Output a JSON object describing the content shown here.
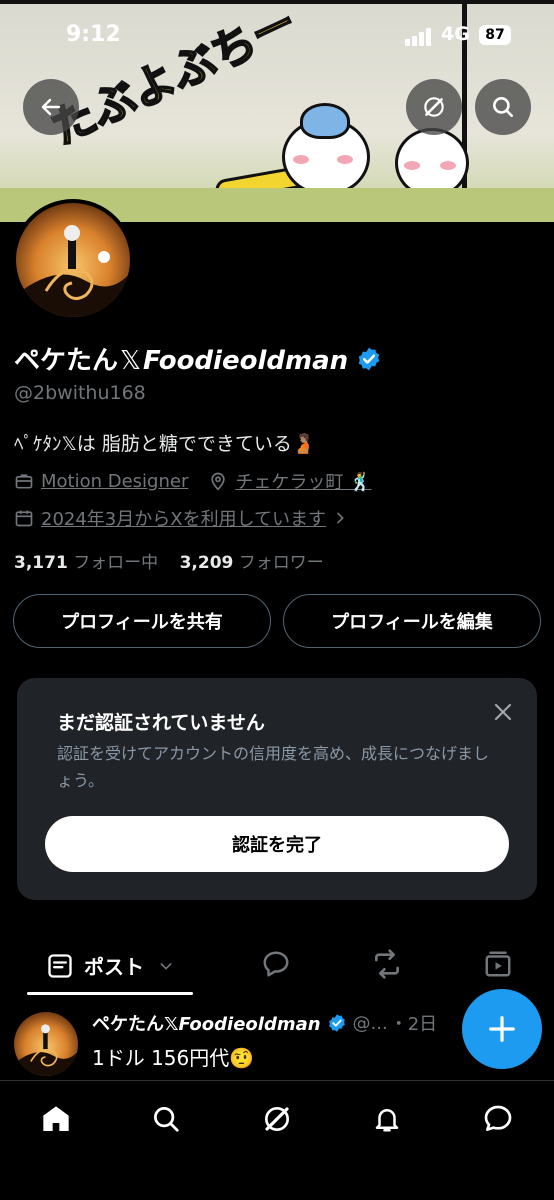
{
  "status_bar": {
    "time": "9:12",
    "network": "4G",
    "battery": "87"
  },
  "header": {
    "back_icon": "arrow-left-icon",
    "grok_icon": "grok-icon",
    "search_icon": "search-icon"
  },
  "banner": {
    "illustration_text": "たぶよぶちー"
  },
  "profile": {
    "name_jp": "ペケたん",
    "name_x": "𝕏",
    "name_en": "Foodieoldman",
    "handle": "@2bwithu168",
    "bio": "ﾍﾟｹﾀﾝ𝕏は 脂肪と糖でできている🫄🏽",
    "job": "Motion Designer",
    "location": "チェケラッ町 🕺",
    "joined": "2024年3月からXを利用しています",
    "following_count": "3,171",
    "following_label": "フォロー中",
    "followers_count": "3,209",
    "followers_label": "フォロワー"
  },
  "actions": {
    "share": "プロフィールを共有",
    "edit": "プロフィールを編集"
  },
  "verify_card": {
    "title": "まだ認証されていません",
    "description": "認証を受けてアカウントの信用度を高め、成長につなげましょう。",
    "button": "認証を完了"
  },
  "tabs": {
    "posts": "ポスト"
  },
  "post": {
    "name_jp": "ペケたん",
    "name_x": "𝕏",
    "name_en": "Foodieoldman",
    "handle_trunc": "@...",
    "time": "・2日",
    "text": "1ドル 156円代🤨"
  },
  "colors": {
    "accent": "#1d9bf0",
    "background": "#000000",
    "card": "#202327",
    "muted": "#71767b"
  }
}
